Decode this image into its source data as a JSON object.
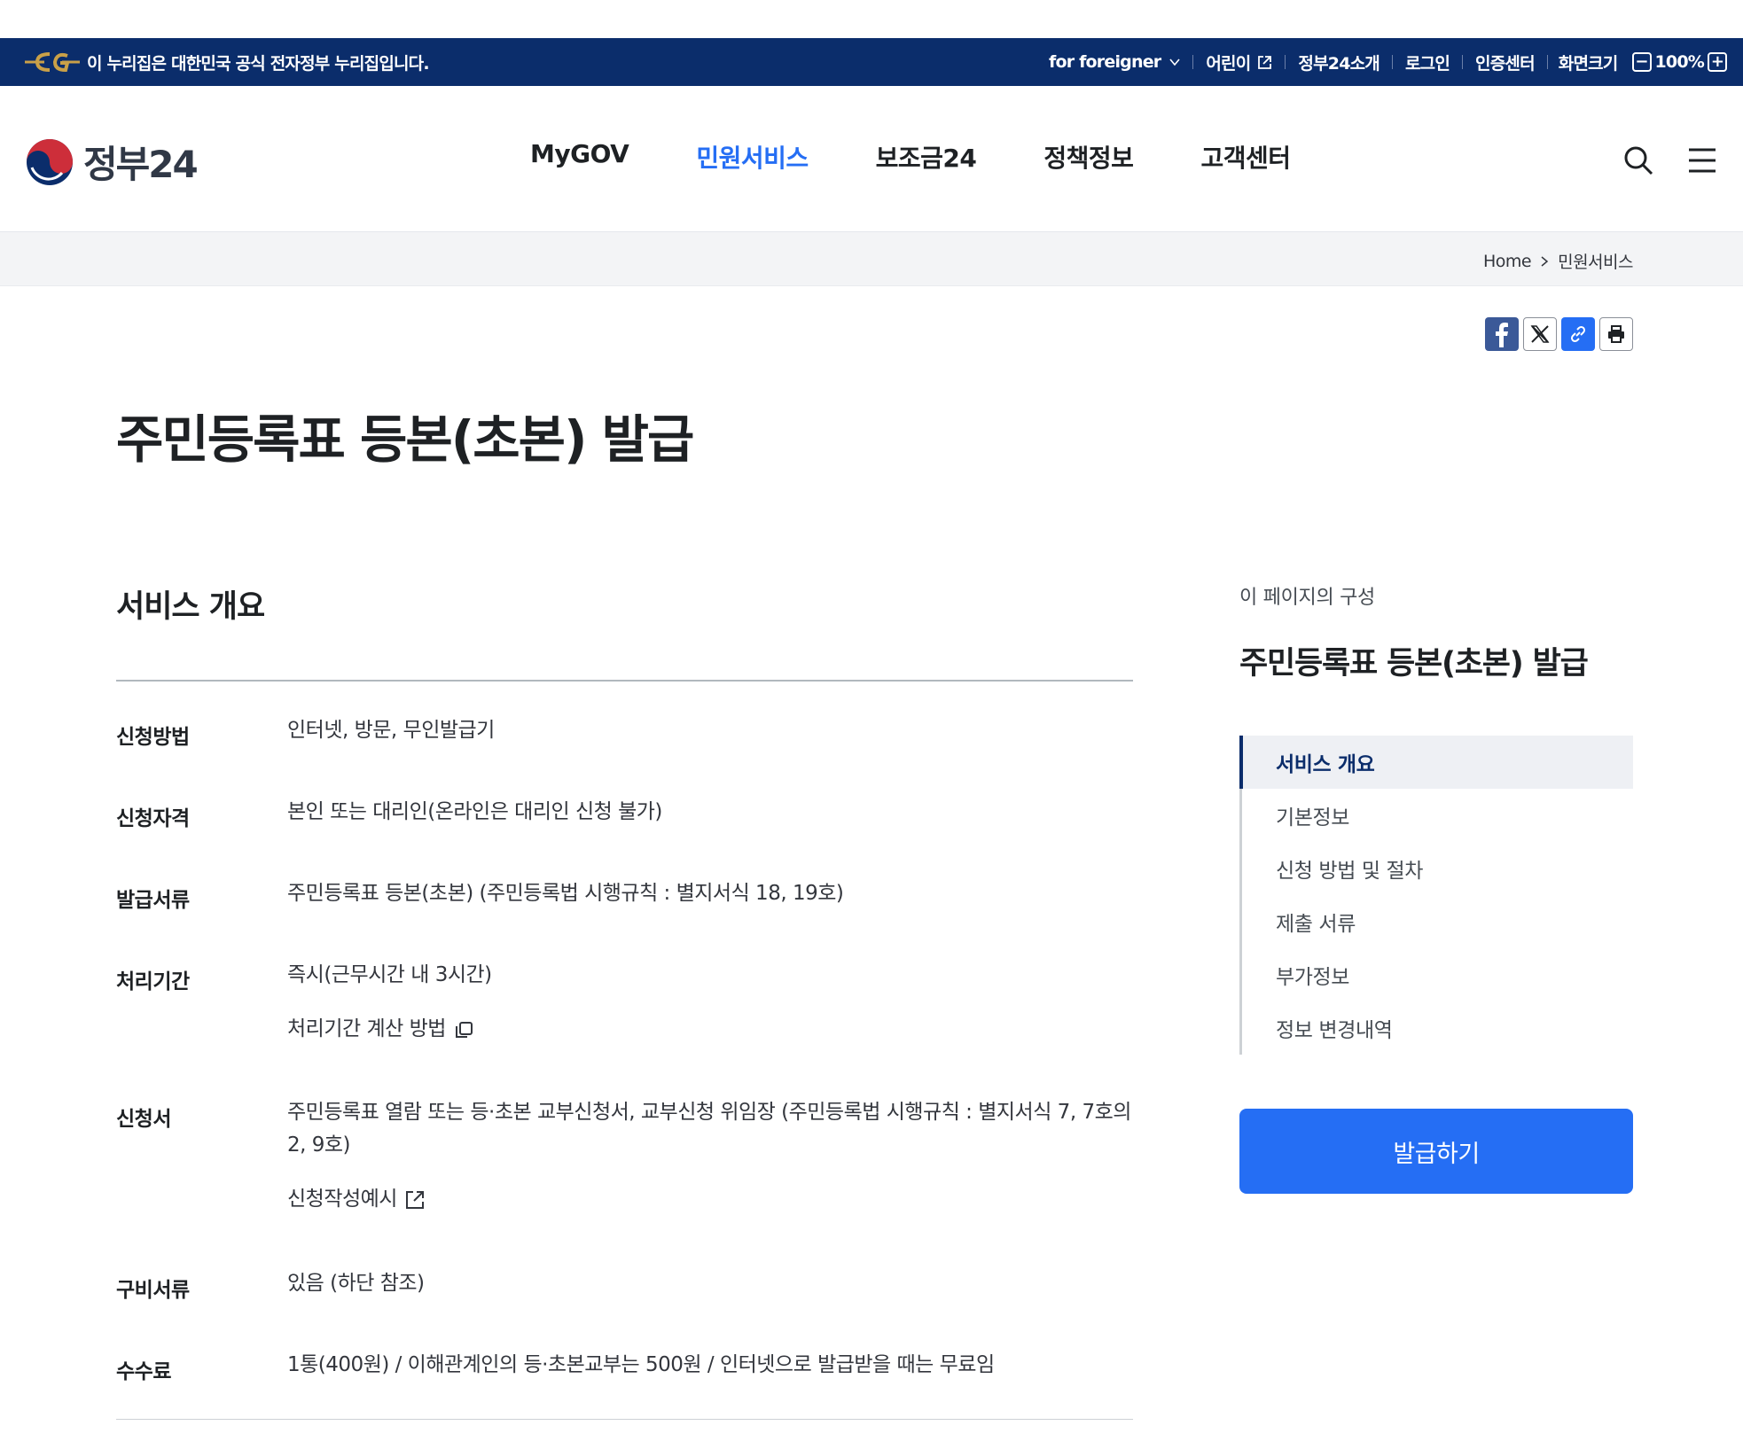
{
  "banner": {
    "text": "이 누리집은 대한민국 공식 전자정부 누리집입니다.",
    "logo_icon": "eg-logo-icon",
    "utility": [
      {
        "label": "for foreigner",
        "icon": "chevron-down-icon"
      },
      {
        "label": "어린이",
        "icon": "external-link-icon"
      },
      {
        "label": "정부24소개"
      },
      {
        "label": "로그인"
      },
      {
        "label": "인증센터"
      },
      {
        "label": "화면크기"
      }
    ],
    "zoom_minus": "−",
    "zoom_value": "100%",
    "zoom_plus": "+"
  },
  "header": {
    "brand": "정부24",
    "nav": [
      {
        "label": "MyGOV",
        "active": false
      },
      {
        "label": "민원서비스",
        "active": true
      },
      {
        "label": "보조금24",
        "active": false
      },
      {
        "label": "정책정보",
        "active": false
      },
      {
        "label": "고객센터",
        "active": false
      }
    ]
  },
  "breadcrumb": {
    "home": "Home",
    "current": "민원서비스"
  },
  "share": [
    "facebook-icon",
    "x-icon",
    "link-icon",
    "print-icon"
  ],
  "page": {
    "title": "주민등록표 등본(초본) 발급"
  },
  "overview": {
    "title": "서비스 개요",
    "rows": [
      {
        "label": "신청방법",
        "value": "인터넷, 방문, 무인발급기"
      },
      {
        "label": "신청자격",
        "value": "본인 또는 대리인(온라인은 대리인 신청 불가)"
      },
      {
        "label": "발급서류",
        "value": "주민등록표 등본(초본) (주민등록법 시행규칙 : 별지서식 18, 19호)"
      },
      {
        "label": "처리기간",
        "value": "즉시(근무시간 내 3시간)",
        "link": "처리기간 계산 방법"
      },
      {
        "label": "신청서",
        "value": "주민등록표 열람 또는 등·초본 교부신청서, 교부신청 위임장 (주민등록법 시행규칙 : 별지서식 7, 7호의2, 9호)",
        "link": "신청작성예시"
      },
      {
        "label": "구비서류",
        "value": "있음 (하단 참조)"
      },
      {
        "label": "수수료",
        "value": "1통(400원) / 이해관계인의 등·초본교부는 500원 / 인터넷으로 발급받을 때는 무료임"
      }
    ]
  },
  "toc": {
    "caption": "이 페이지의 구성",
    "title": "주민등록표 등본(초본) 발급",
    "items": [
      {
        "label": "서비스 개요",
        "active": true
      },
      {
        "label": "기본정보",
        "active": false
      },
      {
        "label": "신청 방법 및 절차",
        "active": false
      },
      {
        "label": "제출 서류",
        "active": false
      },
      {
        "label": "부가정보",
        "active": false
      },
      {
        "label": "정보 변경내역",
        "active": false
      }
    ],
    "button": "발급하기"
  },
  "colors": {
    "banner_bg": "#0b2d6b",
    "accent": "#256ef4",
    "crumb_bg": "#f3f4f6"
  }
}
